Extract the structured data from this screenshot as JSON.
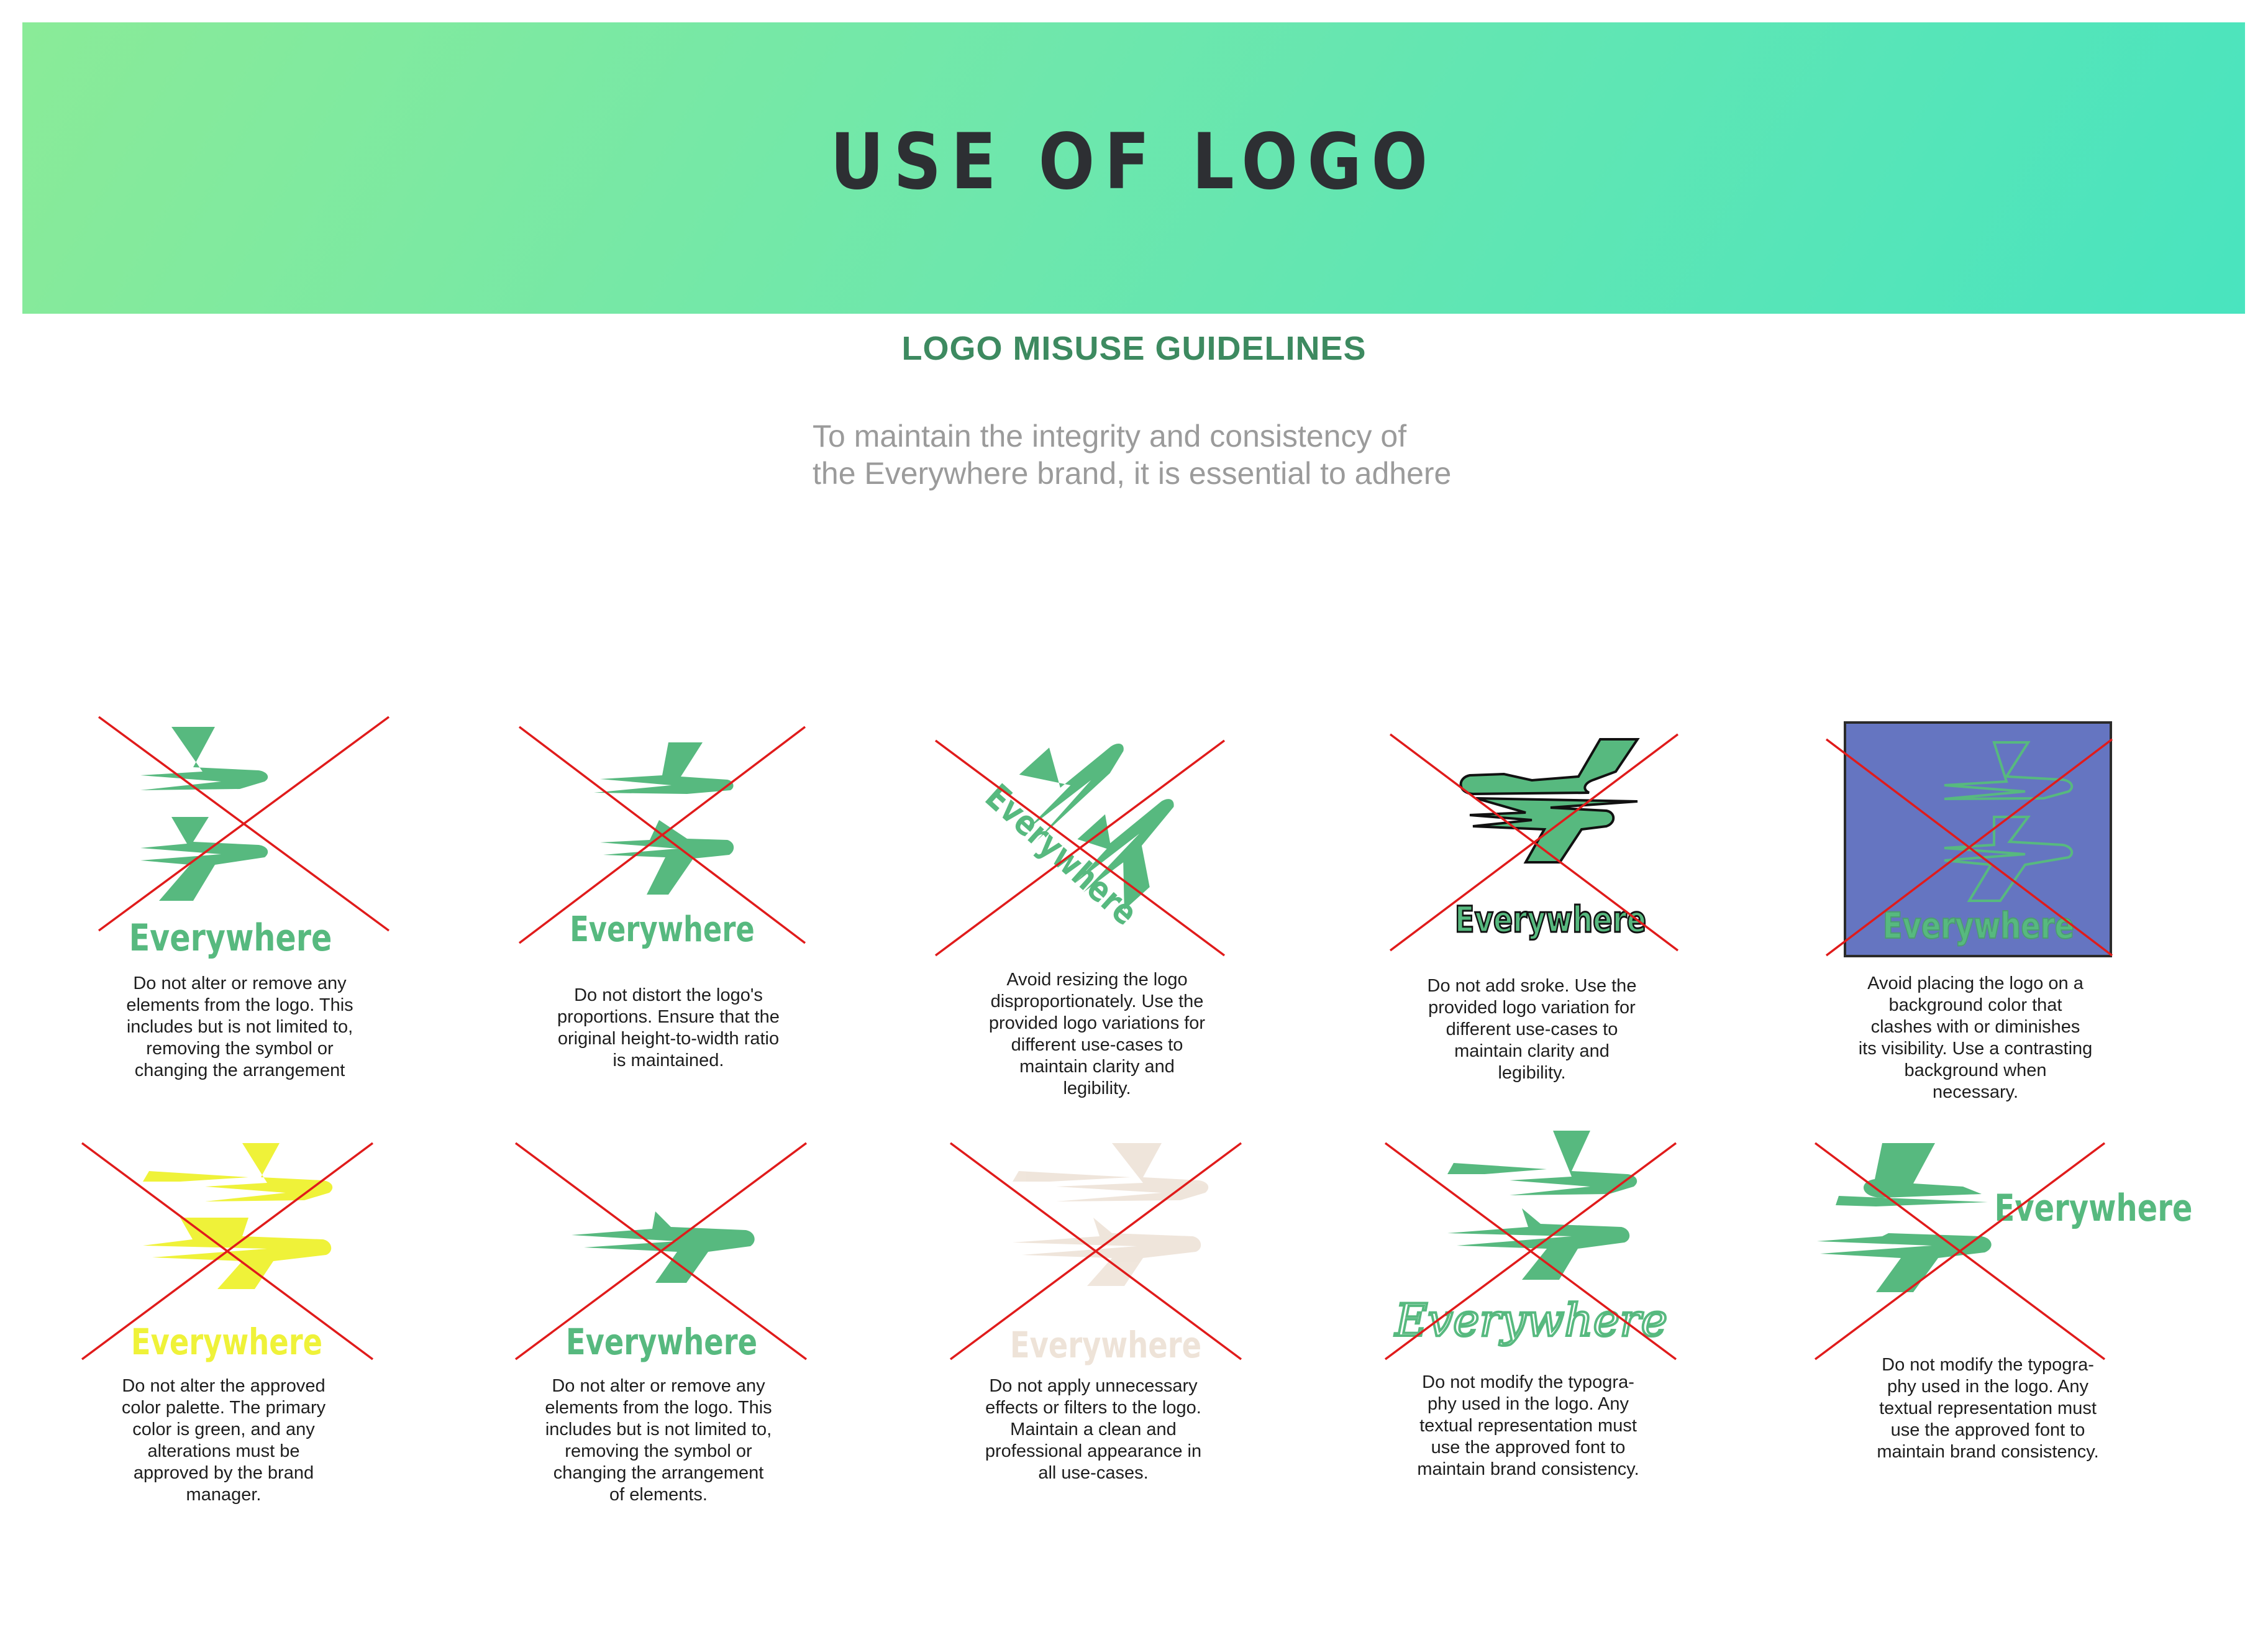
{
  "header": {
    "title": "USE OF LOGO",
    "subtitle": "LOGO MISUSE GUIDELINES",
    "intro_lines": [
      "To maintain the integrity and consistency of",
      "the Everywhere brand, it is essential to adhere"
    ]
  },
  "colors": {
    "brand_green": "#57b97f",
    "cross_red": "#e01b1b",
    "banner_start": "#8aeb98",
    "banner_end": "#49e4bf",
    "title_text": "#2d2f33",
    "subtitle_text": "#3d8a60",
    "yellow_variant": "#eff239",
    "faded_variant": "#eee3d8",
    "clash_background": "#6575c1"
  },
  "logo_wordmark": "Everywhere",
  "guidelines": [
    {
      "variant": "symbol-removed",
      "caption": [
        "Do not alter or remove any",
        "elements from the logo. This",
        "includes but is not limited to,",
        "removing the symbol or",
        "changing the arrangement"
      ]
    },
    {
      "variant": "distorted",
      "caption": [
        "Do not distort the logo's",
        "proportions. Ensure that the",
        "original height-to-width ratio",
        "is maintained."
      ]
    },
    {
      "variant": "rotated",
      "caption": [
        "Avoid resizing the logo",
        "disproportionately. Use the",
        "provided logo variations for",
        "different use-cases to",
        "maintain clarity and",
        "legibility."
      ]
    },
    {
      "variant": "stroke",
      "caption": [
        "Do not add sroke. Use the",
        "provided logo variation for",
        "different use-cases to",
        "maintain clarity and",
        "legibility."
      ]
    },
    {
      "variant": "clashing-background",
      "caption": [
        "Avoid placing the logo on a",
        "background color that",
        "clashes with or diminishes",
        "its visibility. Use a contrasting",
        "background when",
        "necessary."
      ]
    },
    {
      "variant": "recolored",
      "caption": [
        "Do not alter the approved",
        "color palette. The primary",
        "color is green, and any",
        "alterations must be",
        "approved by the brand",
        "manager."
      ]
    },
    {
      "variant": "element-removed",
      "caption": [
        "Do not alter or remove any",
        "elements from the logo. This",
        "includes but is not limited to,",
        "removing the symbol or",
        "changing the arrangement",
        "of elements."
      ]
    },
    {
      "variant": "effects",
      "caption": [
        "Do not apply unnecessary",
        "effects or filters to the logo.",
        "Maintain a clean and",
        "professional appearance in",
        "all use-cases."
      ]
    },
    {
      "variant": "script-font",
      "caption": [
        "Do not modify the typogra-",
        "phy used in the logo. Any",
        "textual representation must",
        "use the approved font to",
        "maintain brand consistency."
      ]
    },
    {
      "variant": "horizontal",
      "caption": [
        "Do not modify the typogra-",
        "phy used in the logo. Any",
        "textual representation must",
        "use the approved font to",
        "maintain brand consistency."
      ]
    }
  ]
}
